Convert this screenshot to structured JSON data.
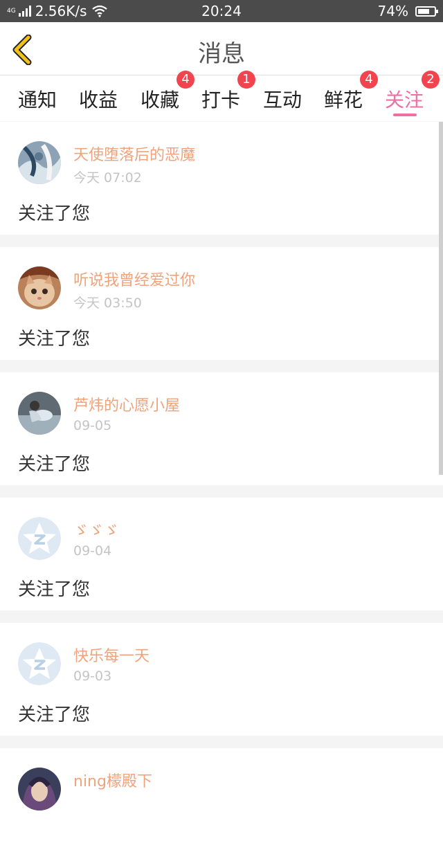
{
  "status_bar": {
    "network_type": "4G",
    "speed": "2.56K/s",
    "time": "20:24",
    "battery": "74%",
    "battery_level": 0.74
  },
  "header": {
    "title": "消息"
  },
  "tabs": [
    {
      "label": "通知",
      "badge": ""
    },
    {
      "label": "收益",
      "badge": ""
    },
    {
      "label": "收藏",
      "badge": "4"
    },
    {
      "label": "打卡",
      "badge": "1"
    },
    {
      "label": "互动",
      "badge": ""
    },
    {
      "label": "鲜花",
      "badge": "4"
    },
    {
      "label": "关注",
      "badge": "2",
      "active": true
    }
  ],
  "messages": [
    {
      "name": "天使堕落后的恶魔",
      "time": "今天 07:02",
      "text": "关注了您",
      "avatar": "photo-avatar-icon"
    },
    {
      "name": "听说我曾经爱过你",
      "time": "今天 03:50",
      "text": "关注了您",
      "avatar": "kitten-avatar-icon"
    },
    {
      "name": "芦炜的心愿小屋",
      "time": "09-05",
      "text": "关注了您",
      "avatar": "photo-avatar-icon"
    },
    {
      "name": "ゞゞゞ",
      "time": "09-04",
      "text": "关注了您",
      "avatar": "default-z-avatar-icon"
    },
    {
      "name": "快乐每一天",
      "time": "09-03",
      "text": "关注了您",
      "avatar": "default-z-avatar-icon"
    },
    {
      "name": "ning檬殿下",
      "time": "",
      "text": "",
      "avatar": "photo-avatar-icon"
    }
  ],
  "colors": {
    "accent": "#ef6fa2",
    "name": "#f0a27b",
    "badge": "#f0454e",
    "back_icon": "#f2c21a"
  }
}
